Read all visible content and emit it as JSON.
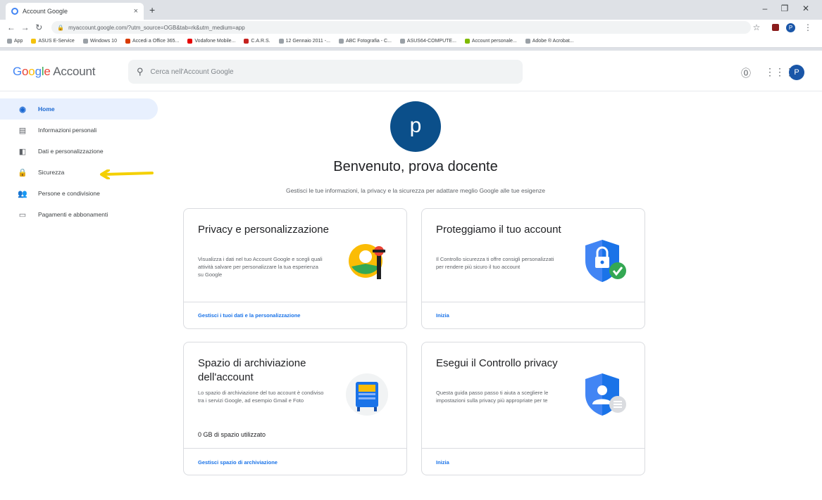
{
  "browser": {
    "tab_title": "Account Google",
    "tab_close": "×",
    "new_tab": "+",
    "url": "myaccount.google.com/?utm_source=OGB&tab=rk&utm_medium=app",
    "win_minimize": "–",
    "win_restore": "❐",
    "win_close": "✕",
    "bookmarks": [
      "App",
      "ASUS E-Service",
      "Windows 10",
      "Accedi a Office 365...",
      "Vodafone Mobile...",
      "C.A.R.S.",
      "12 Gennaio 2011 -...",
      "ABC Fotografia - C...",
      "ASUS64-COMPUTE...",
      "Account personale...",
      "Adobe ® Acrobat..."
    ],
    "profile_initial": "P"
  },
  "header": {
    "logo_g": "G",
    "logo_o1": "o",
    "logo_o2": "o",
    "logo_g2": "g",
    "logo_l": "l",
    "logo_e": "e",
    "logo_suffix": " Account",
    "search_placeholder": "Cerca nell'Account Google",
    "avatar_initial": "P"
  },
  "sidebar": {
    "items": [
      {
        "label": "Home",
        "icon": "account-circle-icon",
        "glyph": "◉"
      },
      {
        "label": "Informazioni personali",
        "icon": "id-card-icon",
        "glyph": "▤"
      },
      {
        "label": "Dati e personalizzazione",
        "icon": "toggle-icon",
        "glyph": "◧"
      },
      {
        "label": "Sicurezza",
        "icon": "lock-icon",
        "glyph": "🔒"
      },
      {
        "label": "Persone e condivisione",
        "icon": "people-icon",
        "glyph": "👥"
      },
      {
        "label": "Pagamenti e abbonamenti",
        "icon": "credit-card-icon",
        "glyph": "▭"
      }
    ]
  },
  "main": {
    "avatar_initial": "p",
    "welcome": "Benvenuto, prova docente",
    "subtitle": "Gestisci le tue informazioni, la privacy e la sicurezza per adattare meglio Google alle tue esigenze",
    "cards": [
      {
        "title": "Privacy e personalizzazione",
        "body": "Visualizza i dati nel tuo Account Google e scegli quali attività salvare per personalizzare la tua esperienza su Google",
        "link": "Gestisci i tuoi dati e la personalizzazione"
      },
      {
        "title": "Proteggiamo il tuo account",
        "body": "Il Controllo sicurezza ti offre consigli personalizzati per rendere più sicuro il tuo account",
        "link": "Inizia"
      },
      {
        "title": "Spazio di archiviazione dell'account",
        "body": "Lo spazio di archiviazione del tuo account è condiviso tra i servizi Google, ad esempio Gmail e Foto",
        "usage": "0 GB di spazio utilizzato",
        "link": "Gestisci spazio di archiviazione"
      },
      {
        "title": "Esegui il Controllo privacy",
        "body": "Questa guida passo passo ti aiuta a scegliere le impostazioni sulla privacy più appropriate per te",
        "link": "Inizia"
      }
    ]
  },
  "colors": {
    "accent": "#1a73e8",
    "avatar": "#0b4f8a",
    "arrow": "#f4d000"
  }
}
